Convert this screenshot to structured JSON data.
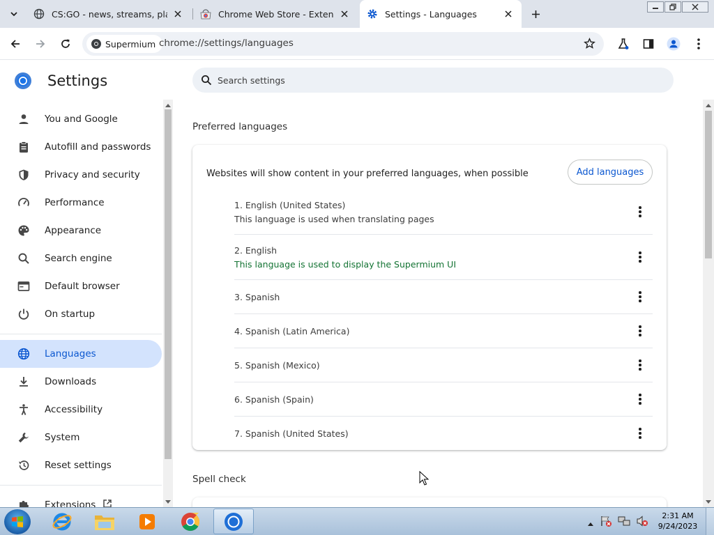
{
  "browser": {
    "tabs": [
      {
        "title": "CS:GO - news, streams, players",
        "favicon": "globe-icon",
        "active": false
      },
      {
        "title": "Chrome Web Store - Extensions",
        "favicon": "chrome-web-store-icon",
        "active": false
      },
      {
        "title": "Settings - Languages",
        "favicon": "gear-icon",
        "active": true
      }
    ],
    "site_chip": "Supermium",
    "url": "chrome://settings/languages"
  },
  "settings": {
    "title": "Settings",
    "search_placeholder": "Search settings",
    "nav": [
      {
        "label": "You and Google",
        "icon": "person-icon"
      },
      {
        "label": "Autofill and passwords",
        "icon": "clipboard-icon"
      },
      {
        "label": "Privacy and security",
        "icon": "shield-icon"
      },
      {
        "label": "Performance",
        "icon": "speedometer-icon"
      },
      {
        "label": "Appearance",
        "icon": "palette-icon"
      },
      {
        "label": "Search engine",
        "icon": "search-icon"
      },
      {
        "label": "Default browser",
        "icon": "browser-window-icon"
      },
      {
        "label": "On startup",
        "icon": "power-icon"
      },
      {
        "label": "Languages",
        "icon": "globe-icon",
        "active": true
      },
      {
        "label": "Downloads",
        "icon": "download-icon"
      },
      {
        "label": "Accessibility",
        "icon": "accessibility-icon"
      },
      {
        "label": "System",
        "icon": "wrench-icon"
      },
      {
        "label": "Reset settings",
        "icon": "history-icon"
      },
      {
        "label": "Extensions",
        "icon": "puzzle-icon"
      }
    ],
    "preferred_section_title": "Preferred languages",
    "card_description": "Websites will show content in your preferred languages, when possible",
    "add_languages_label": "Add languages",
    "languages": [
      {
        "name": "1. English (United States)",
        "note": "This language is used when translating pages"
      },
      {
        "name": "2. English",
        "note": "This language is used to display the Supermium UI"
      },
      {
        "name": "3. Spanish"
      },
      {
        "name": "4. Spanish (Latin America)"
      },
      {
        "name": "5. Spanish (Mexico)"
      },
      {
        "name": "6. Spanish (Spain)"
      },
      {
        "name": "7. Spanish (United States)"
      }
    ],
    "spell_check_title": "Spell check"
  },
  "taskbar": {
    "time": "2:31 AM",
    "date": "9/24/2023",
    "apps": [
      "internet-explorer-icon",
      "file-explorer-icon",
      "media-player-icon",
      "chrome-icon",
      "supermium-icon"
    ]
  },
  "colors": {
    "accent": "#0b57d0",
    "active_nav_bg": "#d3e3fd",
    "ui_note_green": "#137333"
  }
}
